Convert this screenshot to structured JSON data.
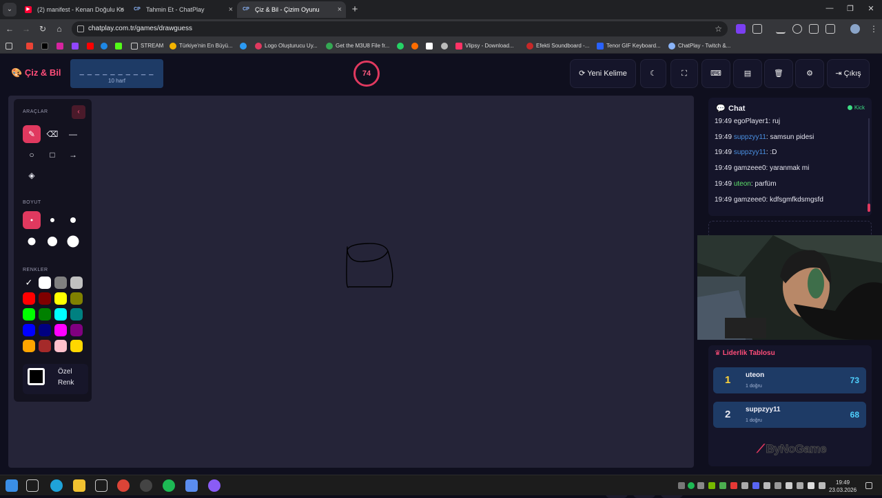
{
  "browser": {
    "tabs": [
      {
        "title": "(2) manifest - Kenan Doğulu Ko"
      },
      {
        "title": "Tahmin Et - ChatPlay"
      },
      {
        "title": "Çiz & Bil - Çizim Oyunu"
      }
    ],
    "url": "chatplay.com.tr/games/drawguess",
    "bookmarks": [
      "STREAM",
      "Türkiye'nin En Büyü...",
      "Logo Oluşturucu Uy...",
      "Get the M3U8 File fr...",
      "Vlipsy - Download...",
      "Efekti Soundboard -...",
      "Tenor GIF Keyboard...",
      "ChatPlay - Twitch &..."
    ],
    "tab_favicon": "CP"
  },
  "game": {
    "brand": "Çiz & Bil",
    "word_mask": "_ _ _ _ _ _ _ _ _ _",
    "word_hint": "10 harf",
    "timer": "74",
    "buttons": {
      "new_word": "Yeni Kelime",
      "exit": "Çıkış"
    }
  },
  "tools": {
    "tools_label": "ARAÇLAR",
    "size_label": "BOYUT",
    "colors_label": "RENKLER",
    "custom_color": [
      "Özel",
      "Renk"
    ],
    "palette": [
      "#000000",
      "#ffffff",
      "#808080",
      "#c0c0c0",
      "#ff0000",
      "#800000",
      "#ffff00",
      "#808000",
      "#00ff00",
      "#008000",
      "#00ffff",
      "#008080",
      "#0000ff",
      "#000080",
      "#ff00ff",
      "#800080",
      "#ffa500",
      "#a52a2a",
      "#ffc0cb",
      "#ffd700"
    ]
  },
  "chat": {
    "title": "Chat",
    "platform": "Kick",
    "messages": [
      {
        "time": "19:49",
        "user": "egoPlayer1",
        "text": "ruj",
        "color": "plain"
      },
      {
        "time": "19:49",
        "user": "suppzyy11",
        "text": "samsun pidesi",
        "color": "blue"
      },
      {
        "time": "19:49",
        "user": "suppzyy11",
        "text": ":D",
        "color": "blue"
      },
      {
        "time": "19:49",
        "user": "gamzeee0",
        "text": "yaranmak mi",
        "color": "plain"
      },
      {
        "time": "19:49",
        "user": "uteon",
        "text": "parfüm",
        "color": "green"
      },
      {
        "time": "19:49",
        "user": "gamzeee0",
        "text": "kdfsgmfkdsmgsfd",
        "color": "plain"
      }
    ]
  },
  "leaderboard": {
    "title": "Liderlik Tablosu",
    "rows": [
      {
        "rank": "1",
        "name": "uteon",
        "sub": "1 doğru",
        "score": "73",
        "rank_color": "#ffd43b"
      },
      {
        "rank": "2",
        "name": "suppzyy11",
        "sub": "1 doğru",
        "score": "68",
        "rank_color": "#e8e8f0"
      }
    ],
    "logo": "ByNoGame"
  },
  "taskbar": {
    "time": "19:49",
    "date": "23.03.2026"
  }
}
